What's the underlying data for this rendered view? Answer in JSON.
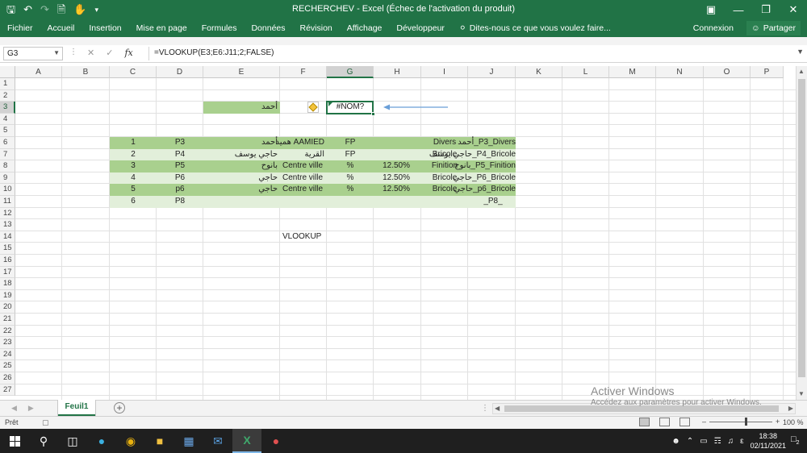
{
  "window": {
    "title": "RECHERCHEV - Excel (Échec de l'activation du produit)",
    "qat_icons": [
      "save-icon",
      "undo-icon",
      "redo-icon",
      "print-preview-icon",
      "touch-mode-icon",
      "customize-qat-icon"
    ]
  },
  "ribbon": {
    "tabs": [
      "Fichier",
      "Accueil",
      "Insertion",
      "Mise en page",
      "Formules",
      "Données",
      "Révision",
      "Affichage",
      "Développeur"
    ],
    "tell_me": "Dites-nous ce que vous voulez faire...",
    "signin": "Connexion",
    "share": "Partager"
  },
  "formula_bar": {
    "name_box": "G3",
    "formula": "=VLOOKUP(E3;E6:J11;2;FALSE)"
  },
  "grid": {
    "columns": [
      "A",
      "B",
      "C",
      "D",
      "E",
      "F",
      "G",
      "H",
      "I",
      "J",
      "K",
      "L",
      "M",
      "N",
      "O",
      "P"
    ],
    "rows": [
      "1",
      "2",
      "3",
      "4",
      "5",
      "6",
      "7",
      "8",
      "9",
      "10",
      "11",
      "12",
      "13",
      "14",
      "15",
      "16",
      "17",
      "18",
      "19",
      "20",
      "21",
      "22",
      "23",
      "24",
      "25",
      "26",
      "27"
    ],
    "selected_cell": "G3",
    "lookup_value": "أحمد",
    "result_value": "#NOM?",
    "table": [
      {
        "c": "1",
        "d": "P3",
        "e": "أحمد",
        "f": "AAMIED همید",
        "g": "FP",
        "h": "",
        "i": "Divers",
        "j": "P3_Divers_أحمد"
      },
      {
        "c": "2",
        "d": "P4",
        "e": "حاجي يوسف",
        "f": "القرية",
        "g": "FP",
        "h": "",
        "i": "Bricole",
        "j": "P4_Bricole_حاجي يوسف"
      },
      {
        "c": "3",
        "d": "P5",
        "e": "بانوح",
        "f": "Centre ville",
        "g": "%",
        "h": "12.50%",
        "i": "Finition",
        "j": "P5_Finition_بانوح"
      },
      {
        "c": "4",
        "d": "P6",
        "e": "حاجي",
        "f": "Centre ville",
        "g": "%",
        "h": "12.50%",
        "i": "Bricole",
        "j": "P6_Bricole_حاجي"
      },
      {
        "c": "5",
        "d": "p6",
        "e": "حاجي",
        "f": "Centre ville",
        "g": "%",
        "h": "12.50%",
        "i": "Bricole",
        "j": "p6_Bricole_حاجي"
      },
      {
        "c": "6",
        "d": "P8",
        "e": "",
        "f": "",
        "g": "",
        "h": "",
        "i": "",
        "j": "_P8_"
      }
    ],
    "note_f14": "VLOOKUP"
  },
  "sheets": {
    "active": "Feuil1"
  },
  "status": {
    "ready": "Prêt",
    "zoom": "100 %"
  },
  "watermark": {
    "line1": "Activer Windows",
    "line2": "Accédez aux paramètres pour activer Windows."
  },
  "taskbar": {
    "time": "18:38",
    "date": "02/11/2021",
    "notifications": "2"
  },
  "colors": {
    "excel_green": "#217346",
    "fill_dark": "#a9d08e",
    "fill_light": "#e2efda",
    "arrow": "#6a9fd8"
  }
}
